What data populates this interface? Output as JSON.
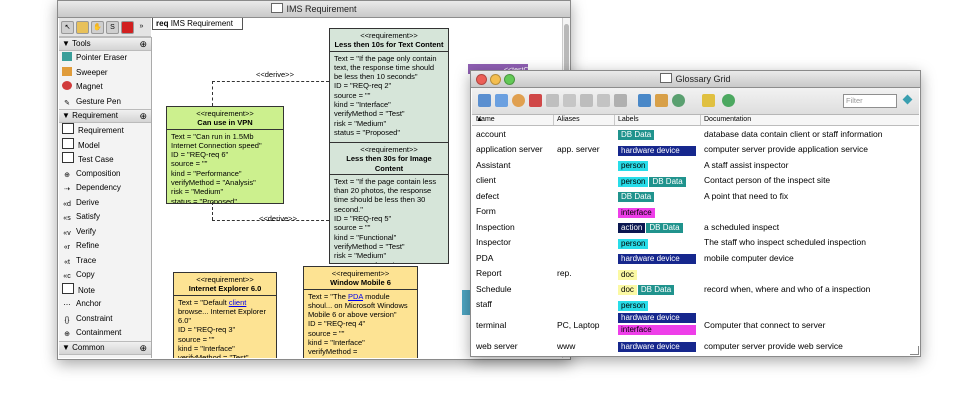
{
  "req_window": {
    "title": "IMS Requirement",
    "diagram_tab": {
      "prefix": "req",
      "name": "IMS Requirement"
    },
    "palette": {
      "tools_header": "Tools",
      "tools": [
        "Pointer Eraser",
        "Sweeper",
        "Magnet",
        "Gesture Pen"
      ],
      "requirement_header": "Requirement",
      "requirement_items": [
        "Requirement",
        "Model",
        "Test Case",
        "Composition",
        "Dependency",
        "Derive",
        "Satisfy",
        "Verify",
        "Refine",
        "Trace",
        "Copy",
        "Note",
        "Anchor",
        "Constraint",
        "Containment"
      ],
      "common_header": "Common"
    },
    "stereotype": "<<requirement>>",
    "requirements": [
      {
        "name": "Less then 10s for Text Content",
        "body": "Text = \"If the page only contain text, the response time should be less then 10 seconds\"\nID = \"REQ-req 2\"\nsource = \"\"\nkind = \"Interface\"\nverifyMethod = \"Test\"\nrisk = \"Medium\"\nstatus = \"Proposed\""
      },
      {
        "name": "Can use in VPN",
        "body": "Text = \"Can run in 1.5Mb Internet Connection speed\"\nID = \"REQ-req 6\"\nsource = \"\"\nkind = \"Performance\"\nverifyMethod = \"Analysis\"\nrisk = \"Medium\"\nstatus = \"Proposed\""
      },
      {
        "name": "Less then 30s for Image Content",
        "body": "Text = \"If the page contain less than 20 photos, the response time should be less then 30 second.\"\nID = \"REQ-req 5\"\nsource = \"\"\nkind = \"Functional\"\nverifyMethod = \"Test\"\nrisk = \"Medium\"\nstatus = \"Deferred\""
      },
      {
        "name": "Internet Explorer 6.0",
        "body_pre": "Text = \"Default ",
        "link": "client",
        "body_post": " browse... Internet Explorer 6.0\"\nID = \"REQ-req 3\"\nsource = \"\"\nkind = \"Interface\"\nverifyMethod = \"Test\"\nrisk = \"Low\""
      },
      {
        "name": "Window Mobile 6",
        "body_pre": "Text = \"The ",
        "link": "PDA",
        "body_post": " module shoul... on Microsoft Windows Mobile 6 or above version\"\nID = \"REQ-req 4\"\nsource = \"\"\nkind = \"Interface\"\nverifyMethod = \"Demonstration\""
      }
    ],
    "edge_label": "<<derive>>",
    "partial_element": "<<testCase"
  },
  "glossary_window": {
    "title": "Glossary Grid",
    "filter_placeholder": "Filter",
    "columns": {
      "name": "Name",
      "aliases": "Aliases",
      "labels": "Labels",
      "documentation": "Documentation"
    },
    "rows": [
      {
        "name": "account",
        "aliases": "",
        "labels": [
          "DB Data"
        ],
        "doc": "database data contain client or staff information"
      },
      {
        "name": "application server",
        "aliases": "app. server",
        "labels": [
          "hardware device"
        ],
        "doc": "computer server provide application service"
      },
      {
        "name": "Assistant",
        "aliases": "",
        "labels": [
          "person"
        ],
        "doc": "A staff assist inspector"
      },
      {
        "name": "client",
        "aliases": "",
        "labels": [
          "person",
          "DB Data"
        ],
        "doc": "Contact person of the inspect site"
      },
      {
        "name": "defect",
        "aliases": "",
        "labels": [
          "DB Data"
        ],
        "doc": "A point that need to fix"
      },
      {
        "name": "Form",
        "aliases": "",
        "labels": [
          "interface"
        ],
        "doc": ""
      },
      {
        "name": "Inspection",
        "aliases": "",
        "labels": [
          "action",
          "DB Data"
        ],
        "doc": "a scheduled inspect"
      },
      {
        "name": "Inspector",
        "aliases": "",
        "labels": [
          "person"
        ],
        "doc": "The staff who inspect scheduled inspection"
      },
      {
        "name": "PDA",
        "aliases": "",
        "labels": [
          "hardware device"
        ],
        "doc": "mobile computer device"
      },
      {
        "name": "Report",
        "aliases": "rep.",
        "labels": [
          "doc"
        ],
        "doc": ""
      },
      {
        "name": "Schedule",
        "aliases": "",
        "labels": [
          "doc",
          "DB Data"
        ],
        "doc": "record when, where and who of a inspection"
      },
      {
        "name": "staff",
        "aliases": "",
        "labels": [
          "person"
        ],
        "doc": ""
      },
      {
        "name": "terminal",
        "aliases": "PC, Laptop",
        "labels": [
          "hardware device",
          "interface"
        ],
        "doc": "Computer that connect to server"
      },
      {
        "name": "web server",
        "aliases": "www",
        "labels": [
          "hardware device"
        ],
        "doc": "computer server provide web service"
      }
    ]
  }
}
